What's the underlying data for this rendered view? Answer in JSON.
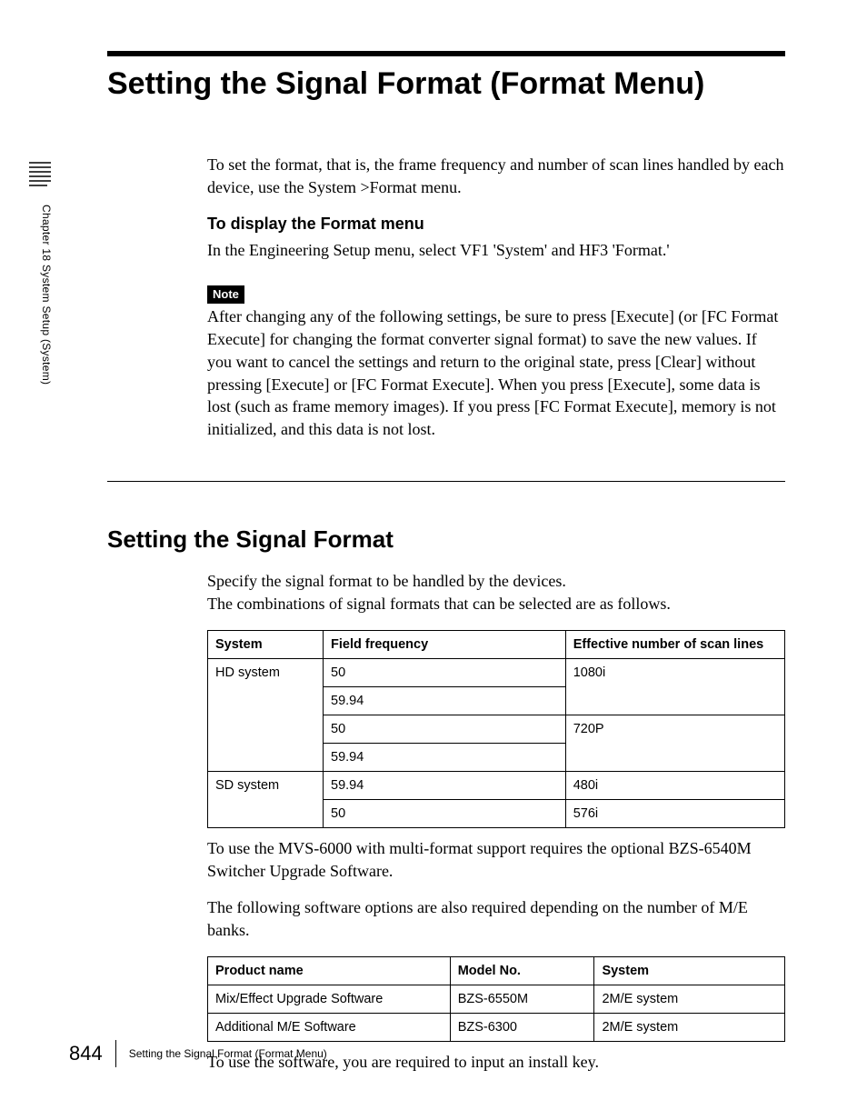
{
  "sidebar": {
    "chapter_line": "Chapter 18  System Setup (System)"
  },
  "title": "Setting the Signal Format (Format Menu)",
  "intro": "To set the format, that is, the frame frequency and number of scan lines handled by each device, use the System >Format menu.",
  "display_head": "To display the Format menu",
  "display_body": "In the Engineering Setup menu, select VF1 'System' and HF3 'Format.'",
  "note_label": "Note",
  "note_body": "After changing any of the following settings, be sure to press [Execute] (or [FC Format Execute] for changing the format converter signal format) to save the new values. If you want to cancel the settings and return to the original state, press [Clear] without pressing [Execute] or [FC Format Execute]. When you press [Execute], some data is lost (such as frame memory images). If you press [FC Format Execute], memory is not initialized, and this data is not lost.",
  "section_title": "Setting the Signal Format",
  "section_intro1": "Specify the signal format to be handled by the devices.",
  "section_intro2": "The combinations of signal formats that can be selected are as follows.",
  "table1": {
    "headers": {
      "c1": "System",
      "c2": "Field frequency",
      "c3": "Effective number of scan lines"
    },
    "r1c1": "HD system",
    "r1c2": "50",
    "r1c3": "1080i",
    "r2c2": "59.94",
    "r3c2": "50",
    "r3c3": "720P",
    "r4c2": "59.94",
    "r5c1": "SD system",
    "r5c2": "59.94",
    "r5c3": "480i",
    "r6c2": "50",
    "r6c3": "576i"
  },
  "after_t1": "To use the MVS-6000 with multi-format support requires the optional BZS-6540M Switcher Upgrade Software.",
  "before_t2": "The following software options are also required depending on the number of M/E banks.",
  "table2": {
    "headers": {
      "c1": "Product name",
      "c2": "Model No.",
      "c3": "System"
    },
    "r1": {
      "c1": "Mix/Effect Upgrade Software",
      "c2": "BZS-6550M",
      "c3": "2M/E system"
    },
    "r2": {
      "c1": "Additional M/E Software",
      "c2": "BZS-6300",
      "c3": "2M/E system"
    }
  },
  "after_t2": "To use the software, you are required to input an install key.",
  "footer": {
    "page": "844",
    "text": "Setting the Signal Format (Format Menu)"
  }
}
